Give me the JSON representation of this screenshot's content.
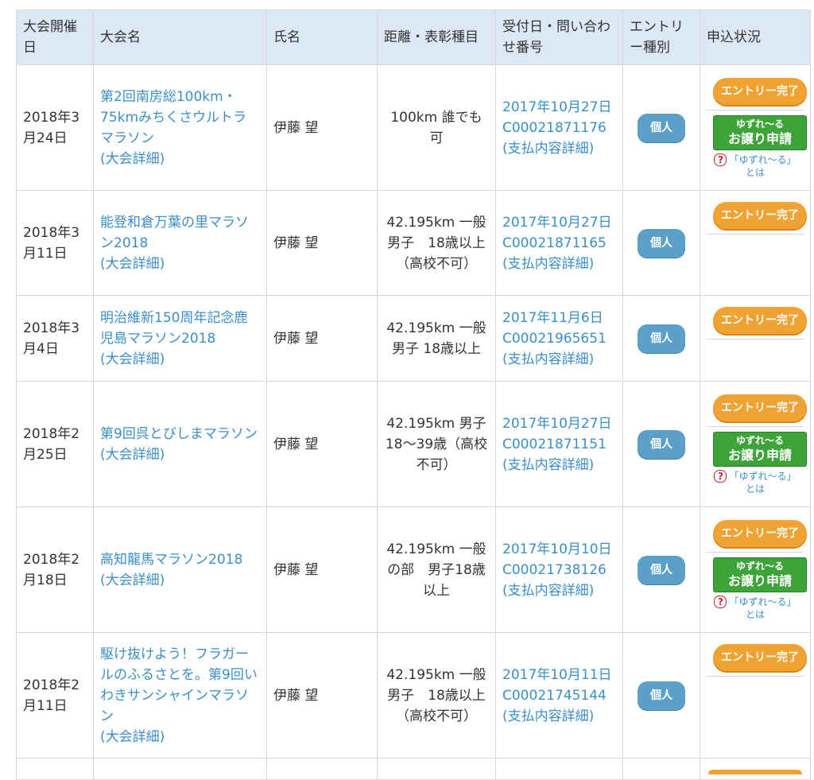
{
  "headers": {
    "date": "大会開催日",
    "event": "大会名",
    "person": "氏名",
    "distance": "距離・表彰種目",
    "received": "受付日・問い合わせ番号",
    "entry_type": "エントリー種別",
    "status": "申込状況"
  },
  "labels": {
    "details_link": "(大会詳細)",
    "payment_link": "(支払内容詳細)",
    "entry_done": "エントリー完了",
    "resale_l1": "ゆずれ〜る",
    "resale_l2": "お譲り申請",
    "resale_help": "「ゆずれ〜る」とは",
    "qmark": "?"
  },
  "rows": [
    {
      "date": "2018年3月24日",
      "event": "第2回南房総100km・75kmみちくさウルトラマラソン",
      "person": "伊藤 望",
      "distance": "100km 誰でも可",
      "received_date": "2017年10月27日",
      "inquiry_no": "C00021871176",
      "type": "個人",
      "resale": true
    },
    {
      "date": "2018年3月11日",
      "event": "能登和倉万葉の里マラソン2018",
      "person": "伊藤 望",
      "distance": "42.195km 一般男子　18歳以上（高校不可）",
      "received_date": "2017年10月27日",
      "inquiry_no": "C00021871165",
      "type": "個人",
      "resale": false
    },
    {
      "date": "2018年3月4日",
      "event": "明治維新150周年記念鹿児島マラソン2018",
      "person": "伊藤 望",
      "distance": "42.195km 一般男子 18歳以上",
      "received_date": "2017年11月6日",
      "inquiry_no": "C00021965651",
      "type": "個人",
      "resale": false
    },
    {
      "date": "2018年2月25日",
      "event": "第9回呉とびしまマラソン",
      "person": "伊藤 望",
      "distance": "42.195km 男子　18〜39歳（高校不可）",
      "received_date": "2017年10月27日",
      "inquiry_no": "C00021871151",
      "type": "個人",
      "resale": true
    },
    {
      "date": "2018年2月18日",
      "event": "高知龍馬マラソン2018",
      "person": "伊藤 望",
      "distance": "42.195km 一般の部　男子18歳以上",
      "received_date": "2017年10月10日",
      "inquiry_no": "C00021738126",
      "type": "個人",
      "resale": true
    },
    {
      "date": "2018年2月11日",
      "event": "駆け抜けよう！フラガールのふるさとを。第9回いわきサンシャインマラソン",
      "person": "伊藤 望",
      "distance": "42.195km 一般男子　18歳以上（高校不可）",
      "received_date": "2017年10月11日",
      "inquiry_no": "C00021745144",
      "type": "個人",
      "resale": false
    }
  ],
  "colors": {
    "header_bg": "#dce8f5",
    "link": "#3a8fc8",
    "entry_done": "#f0a232",
    "resale": "#3ea43a",
    "type_pill": "#5aa0c8"
  }
}
